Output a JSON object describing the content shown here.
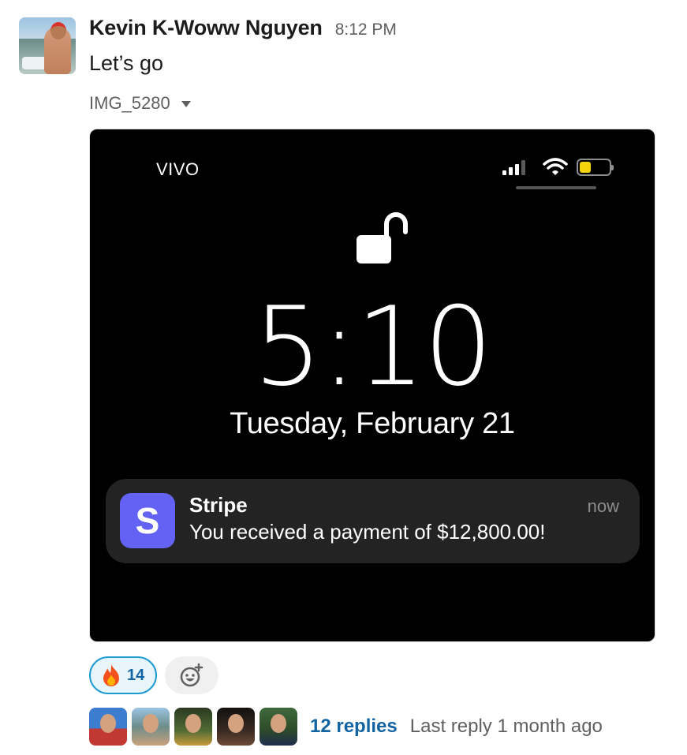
{
  "message": {
    "sender_name": "Kevin K-Woww Nguyen",
    "timestamp": "8:12 PM",
    "text": "Let’s go"
  },
  "attachment": {
    "file_name": "IMG_5280",
    "lock_screen": {
      "carrier": "VIVO",
      "time": "5:10",
      "date": "Tuesday, February 21",
      "battery_color": "#f5d30a",
      "notification": {
        "app_icon_letter": "S",
        "app_icon_color": "#6461f5",
        "app_name": "Stripe",
        "time": "now",
        "body": "You received a payment of $12,800.00!"
      }
    }
  },
  "reactions": [
    {
      "emoji": "fire-icon",
      "count": "14"
    }
  ],
  "thread": {
    "replies_label": "12 replies",
    "last_reply": "Last reply 1 month ago"
  },
  "colors": {
    "link": "#1264a3",
    "reaction_border": "#1d9bd1",
    "reaction_bg": "#e8f5fa"
  }
}
